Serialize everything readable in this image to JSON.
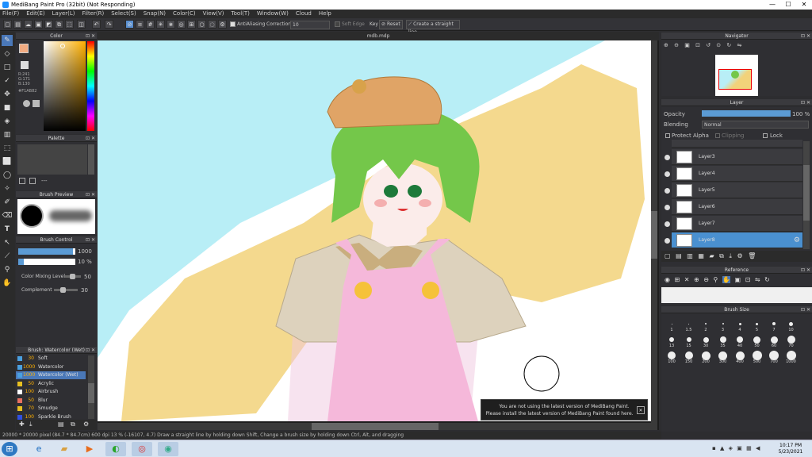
{
  "window": {
    "title": "MediBang Paint Pro (32bit) (Not Responding)",
    "minimize": "—",
    "maximize": "☐",
    "close": "✕"
  },
  "menu": [
    "File(F)",
    "Edit(E)",
    "Layer(L)",
    "Filter(R)",
    "Select(S)",
    "Snap(N)",
    "Color(C)",
    "View(V)",
    "Tool(T)",
    "Window(W)",
    "Cloud",
    "Help"
  ],
  "toolbar": {
    "antialias_label": "AntiAliasing",
    "correction_label": "Correction",
    "correction_value": "10",
    "soft_edge_label": "Soft Edge",
    "key_label": "Key",
    "reset_label": "Reset",
    "straight_line_label": "Create a straight line"
  },
  "document": {
    "tab": "mdb.mdp"
  },
  "color_panel": {
    "title": "Color",
    "r": "R:241",
    "g": "G:171",
    "b": "B:130",
    "hex": "#F1AB82"
  },
  "palette_panel": {
    "title": "Palette",
    "dash": "---"
  },
  "brush_preview": {
    "title": "Brush Preview"
  },
  "brush_control": {
    "title": "Brush Control",
    "size": "1000",
    "opacity": "10 %",
    "mix_label": "Color Mixing Level",
    "mix_value": "50",
    "complement_label": "Complement",
    "complement_value": "30"
  },
  "brush_list": {
    "title": "Brush: Watercolor (Wet)",
    "items": [
      {
        "size": "30",
        "name": "Soft",
        "color": "#4aa0e0"
      },
      {
        "size": "1000",
        "name": "Watercolor",
        "color": "#4aa0e0"
      },
      {
        "size": "1000",
        "name": "Watercolor (Wet)",
        "color": "#4aa0e0",
        "selected": true
      },
      {
        "size": "50",
        "name": "Acrylic",
        "color": "#e8c020"
      },
      {
        "size": "100",
        "name": "Airbrush",
        "color": "#ffffff"
      },
      {
        "size": "50",
        "name": "Blur",
        "color": "#e87060"
      },
      {
        "size": "70",
        "name": "Smudge",
        "color": "#e8c020"
      },
      {
        "size": "100",
        "name": "Sparkle Brush",
        "color": "#3050e0"
      }
    ]
  },
  "navigator": {
    "title": "Navigator"
  },
  "layer_panel": {
    "title": "Layer",
    "opacity_label": "Opacity",
    "opacity_value": "100 %",
    "blending_label": "Blending",
    "blending_value": "Normal",
    "protect_alpha": "Protect Alpha",
    "clipping": "Clipping",
    "lock": "Lock",
    "layers": [
      {
        "name": "Layer3"
      },
      {
        "name": "Layer4"
      },
      {
        "name": "Layer5"
      },
      {
        "name": "Layer6"
      },
      {
        "name": "Layer7"
      },
      {
        "name": "Layer8",
        "selected": true
      }
    ]
  },
  "reference": {
    "title": "Reference"
  },
  "brush_size": {
    "title": "Brush Size",
    "row1": [
      "1",
      "1.5",
      "2",
      "3",
      "4",
      "5",
      "7",
      "10"
    ],
    "row2": [
      "13",
      "15",
      "30",
      "35",
      "40",
      "50",
      "60",
      "70"
    ],
    "row3": [
      "100",
      "150",
      "200",
      "300",
      "400",
      "500",
      "700",
      "1000"
    ]
  },
  "notification": {
    "line1": "You are not using the latest version of MediBang Paint.",
    "line2": "Please install the latest version of MediBang Paint found here.",
    "close": "✕"
  },
  "status": {
    "text": "20000 * 20000 pixel (84.7 * 84.7cm) 600 dpi 13 % (-16107, 4.7) Draw a straight line by holding down Shift, Change a brush size by holding down Ctrl, Alt, and dragging"
  },
  "taskbar": {
    "time": "10:17 PM",
    "date": "5/23/2021"
  }
}
